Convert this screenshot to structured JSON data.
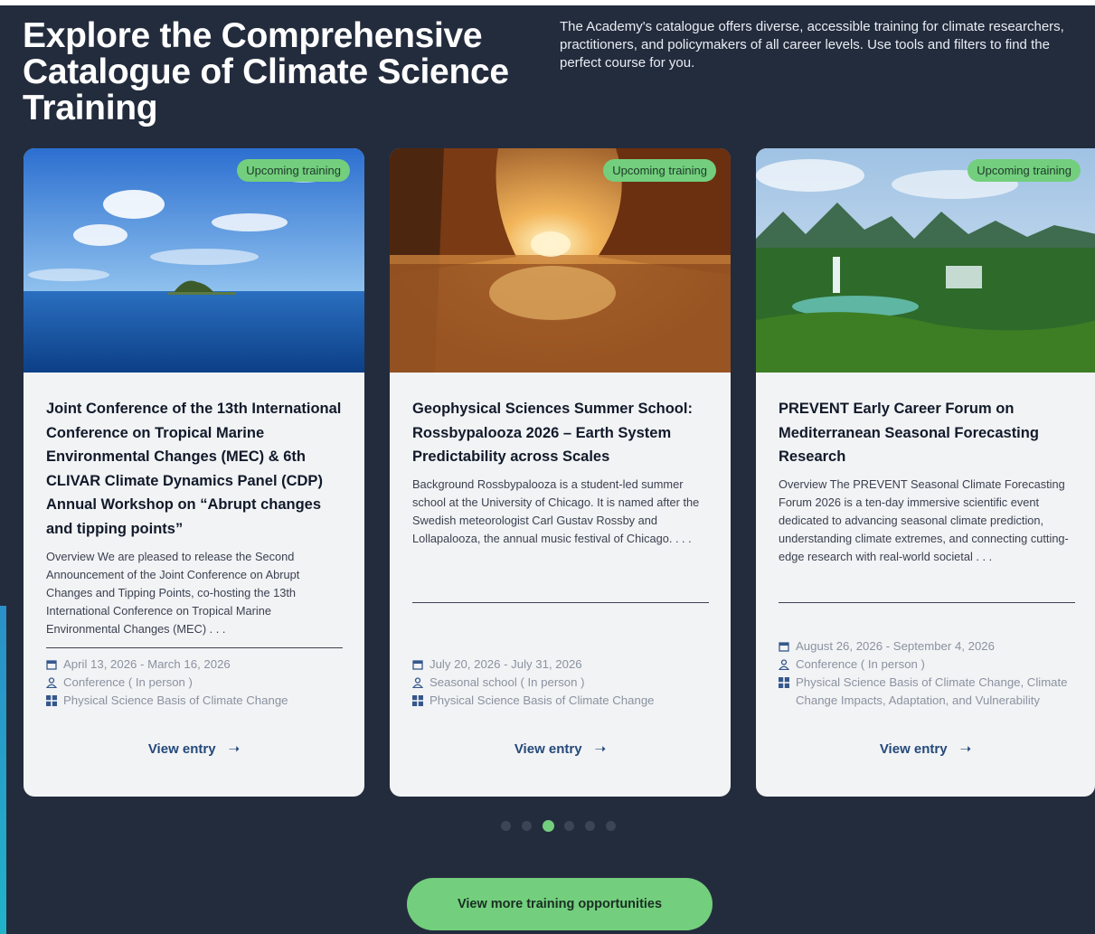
{
  "header": {
    "title": "Explore the Comprehensive Catalogue of Climate Science Training",
    "intro": "The Academy's catalogue offers diverse, accessible training for climate researchers, practitioners, and policymakers of all career levels. Use tools and filters to find the perfect course for you."
  },
  "cards": [
    {
      "badge": "Upcoming training",
      "image_icon": "ocean-island-photo",
      "title": "Joint Conference of the 13th International Conference on Tropical Marine Environmental Changes (MEC) & 6th CLIVAR Climate Dynamics Panel (CDP) Annual Workshop on “Abrupt changes and tipping points”",
      "description": "Overview We are pleased to release the Second Announcement of the Joint Conference on Abrupt Changes and Tipping Points, co-hosting the 13th International Conference on Tropical Marine Environmental Changes (MEC) . . .",
      "dates": "April 13, 2026 - March 16, 2026",
      "type": "Conference ( In person )",
      "topics": "Physical Science Basis of Climate Change",
      "view_label": "View entry"
    },
    {
      "badge": "Upcoming training",
      "image_icon": "autumn-lake-sunset-photo",
      "title": "Geophysical Sciences Summer School: Rossbypalooza 2026 – Earth System Predictability across Scales",
      "description": "Background Rossbypalooza is a student-led summer school at the University of Chicago. It is named after the Swedish meteorologist Carl Gustav Rossby and Lollapalooza, the annual music festival of Chicago. . . .",
      "dates": "July 20, 2026 - July 31, 2026",
      "type": "Seasonal school ( In person )",
      "topics": "Physical Science Basis of Climate Change",
      "view_label": "View entry"
    },
    {
      "badge": "Upcoming training",
      "image_icon": "karst-waterfall-photo",
      "title": "PREVENT Early Career Forum on Mediterranean Seasonal Forecasting Research",
      "description": "Overview The PREVENT Seasonal Climate Forecasting Forum 2026 is a ten-day immersive scientific event dedicated to advancing seasonal climate prediction, understanding climate extremes, and connecting cutting-edge research with real-world societal . . .",
      "dates": "August 26, 2026 - September 4, 2026",
      "type": "Conference ( In person )",
      "topics": "Physical Science Basis of Climate Change, Climate Change Impacts, Adaptation, and Vulnerability",
      "view_label": "View entry"
    }
  ],
  "carousel": {
    "page_count": 6,
    "active_index": 2
  },
  "more_button": "View more training opportunities",
  "colors": {
    "background": "#232c3d",
    "card": "#f2f3f5",
    "accent_green": "#73cf7d",
    "link_blue": "#24497a"
  }
}
